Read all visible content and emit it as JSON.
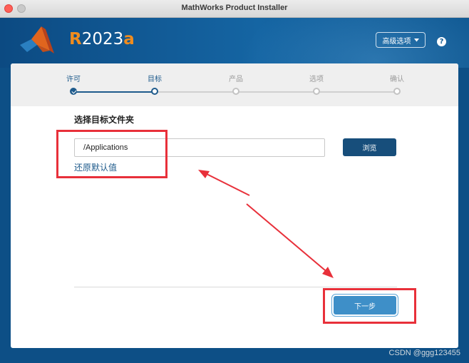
{
  "window": {
    "title": "MathWorks Product Installer"
  },
  "header": {
    "release_prefix": "R",
    "release_number": "2023",
    "release_suffix": "a",
    "advanced_options_label": "高级选项",
    "help_label": "?"
  },
  "steps": [
    {
      "label": "许可",
      "state": "done"
    },
    {
      "label": "目标",
      "state": "current"
    },
    {
      "label": "产品",
      "state": "pending"
    },
    {
      "label": "选项",
      "state": "pending"
    },
    {
      "label": "确认",
      "state": "pending"
    }
  ],
  "main": {
    "section_title": "选择目标文件夹",
    "path_value": "/Applications",
    "browse_label": "浏览",
    "restore_default_label": "还原默认值",
    "next_label": "下一步"
  },
  "annotation": {
    "color": "#e8303a"
  },
  "watermark": "CSDN @ggg123455",
  "colors": {
    "accent": "#1f5b8c",
    "header": "#0f5892",
    "next_button": "#3e8fc8"
  }
}
